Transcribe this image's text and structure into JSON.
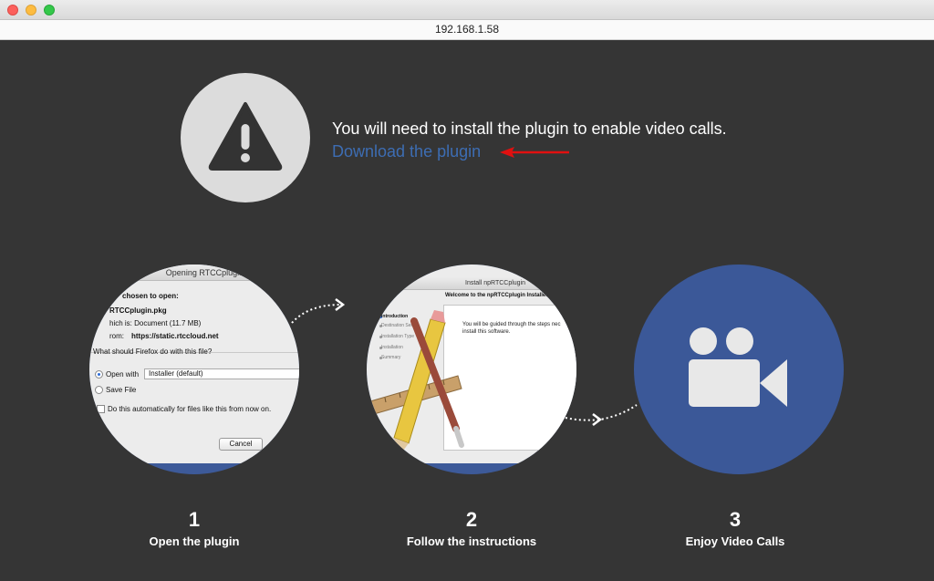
{
  "window": {
    "url": "192.168.1.58"
  },
  "warning": {
    "message": "You will need to install the plugin to enable video calls.",
    "link_label": "Download the plugin"
  },
  "step1_dialog": {
    "title": "Opening RTCCplugin.pkg",
    "chosen_label": "chosen to open:",
    "filename": "RTCCplugin.pkg",
    "which_is": "hich is:  Document (11.7 MB)",
    "from_label": "rom:",
    "from_value": "https://static.rtccloud.net",
    "question": "What should Firefox do with this file?",
    "open_with_label": "Open with",
    "open_with_value": "Installer (default)",
    "save_file_label": "Save File",
    "auto_label": "Do this automatically for files like this from now on.",
    "cancel_label": "Cancel"
  },
  "step2_dialog": {
    "title": "Install npRTCCplugin",
    "welcome": "Welcome to the npRTCCplugin Installer",
    "body_line1": "You will be guided through the steps nec",
    "body_line2": "install this software.",
    "sidebar": [
      "Introduction",
      "Destination Sele",
      "Installation Type",
      "Installation",
      "Summary"
    ]
  },
  "steps": [
    {
      "number": "1",
      "label": "Open the plugin"
    },
    {
      "number": "2",
      "label": "Follow the instructions"
    },
    {
      "number": "3",
      "label": "Enjoy Video Calls"
    }
  ],
  "colors": {
    "background": "#353535",
    "link": "#3d6db3",
    "circle_blue": "#3b5898",
    "warning_circle": "#dcdcdc",
    "arrow_red": "#e01010"
  }
}
